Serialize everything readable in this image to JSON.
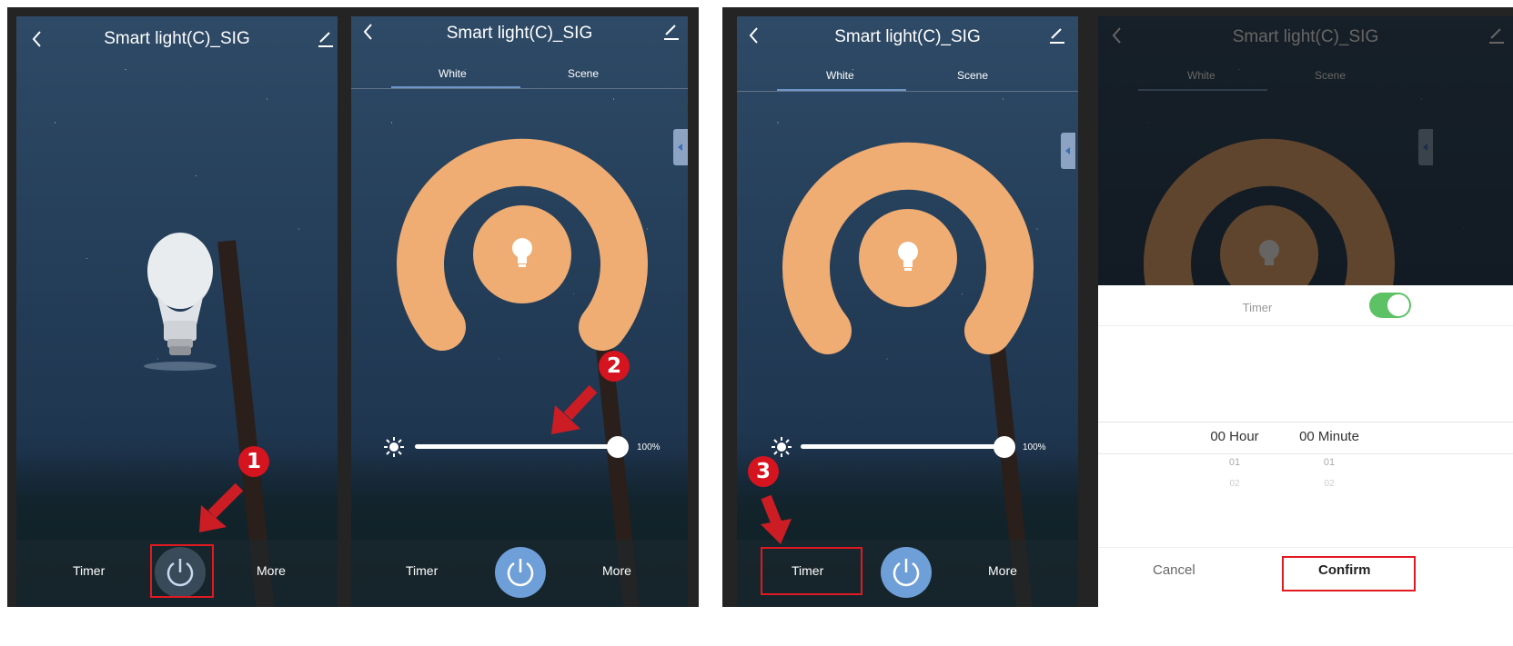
{
  "device_title": "Smart light(C)_SIG",
  "tabs": {
    "white": "White",
    "scene": "Scene"
  },
  "bottom_bar": {
    "timer": "Timer",
    "more": "More"
  },
  "brightness_value": "100%",
  "brightness_level": 1.0,
  "timer_sheet": {
    "title": "Timer",
    "toggle_on": true,
    "hour_selected": "00 Hour",
    "minute_selected": "00 Minute",
    "hour_next": "01",
    "minute_next": "01",
    "hour_next2": "02",
    "minute_next2": "02",
    "cancel": "Cancel",
    "confirm": "Confirm"
  },
  "step_markers": [
    "1",
    "2",
    "3"
  ],
  "colors": {
    "ring": "#efac73",
    "power_active": "#6f9fd8",
    "marker": "#d6141f",
    "toggle": "#5cc265"
  },
  "icons": [
    "back-icon",
    "edit-icon",
    "bulb-icon",
    "power-icon",
    "sun-icon",
    "arrow-icon"
  ]
}
